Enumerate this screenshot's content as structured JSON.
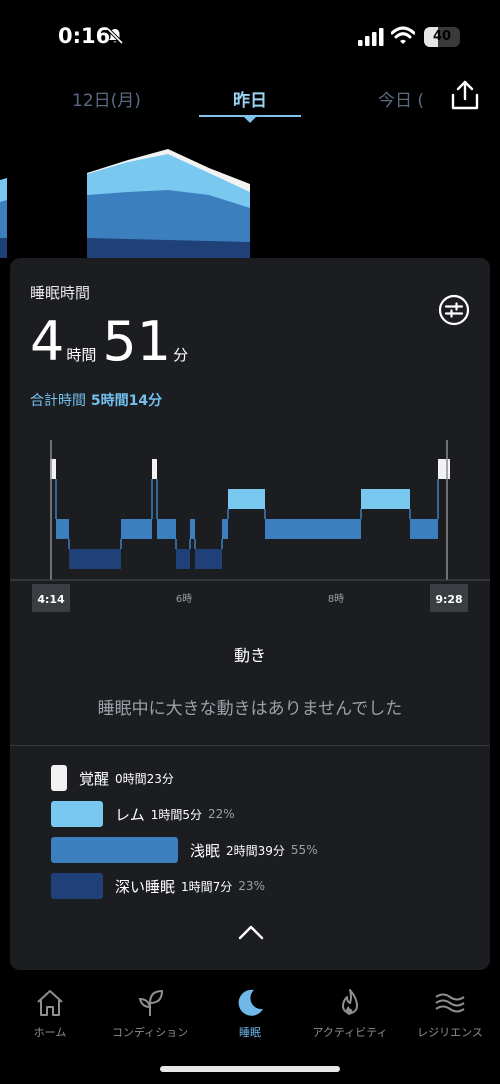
{
  "status_bar": {
    "time": "0:16",
    "battery": "40",
    "battery_level": 0.4
  },
  "date_tabs": {
    "prev": "12日(月)",
    "current": "昨日",
    "next": "今日 ("
  },
  "card": {
    "title": "睡眠時間",
    "duration": {
      "hours": "4",
      "hours_unit": "時間",
      "minutes": "51",
      "minutes_unit": "分"
    },
    "total_label": "合計時間",
    "total_value": "5時間14分",
    "hypnogram": {
      "start_time": "4:14",
      "end_time": "9:28",
      "tick_labels": [
        "6時",
        "8時"
      ],
      "stages": [
        "awake",
        "rem",
        "light",
        "deep"
      ]
    },
    "movement_title": "動き",
    "movement_text": "睡眠中に大きな動きはありませんでした",
    "legend": [
      {
        "label": "覚醒",
        "value": "0時間23分",
        "percent": "",
        "color": "#f2f2f2"
      },
      {
        "label": "レム",
        "value": "1時間5分",
        "percent": "22%",
        "color": "#78c8f0"
      },
      {
        "label": "浅眠",
        "value": "2時間39分",
        "percent": "55%",
        "color": "#3c7fbe"
      },
      {
        "label": "深い睡眠",
        "value": "1時間7分",
        "percent": "23%",
        "color": "#1f4178"
      }
    ]
  },
  "nav": [
    {
      "label": "ホーム",
      "icon": "home-icon"
    },
    {
      "label": "コンディション",
      "icon": "sprout-icon"
    },
    {
      "label": "睡眠",
      "icon": "moon-icon",
      "active": true
    },
    {
      "label": "アクティビティ",
      "icon": "flame-icon"
    },
    {
      "label": "レジリエンス",
      "icon": "waves-icon"
    }
  ]
}
